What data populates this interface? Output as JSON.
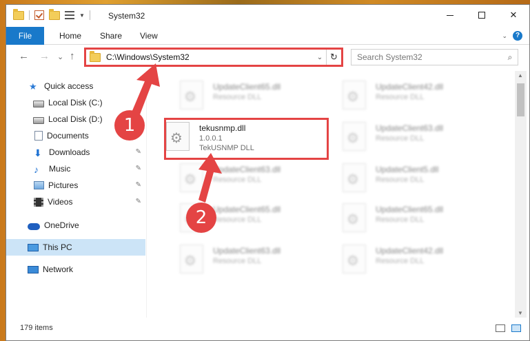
{
  "window": {
    "title": "System32",
    "controls": {
      "minimize": "—",
      "maximize": "□",
      "close": "✕"
    }
  },
  "ribbon": {
    "tabs": [
      "File",
      "Home",
      "Share",
      "View"
    ],
    "help": "?",
    "expand": "⌄"
  },
  "navigation": {
    "back": "←",
    "forward": "→",
    "recent": "⌄",
    "up": "↑",
    "address": "C:\\Windows\\System32",
    "address_dropdown": "⌄",
    "refresh": "↻",
    "search_placeholder": "Search System32",
    "search_icon": "⌕"
  },
  "sidebar": {
    "items": [
      {
        "label": "Quick access",
        "icon": "star-icon"
      },
      {
        "label": "Local Disk (C:)",
        "icon": "local-disk-icon"
      },
      {
        "label": "Local Disk (D:)",
        "icon": "local-disk-icon"
      },
      {
        "label": "Documents",
        "icon": "documents-icon",
        "pinned": true
      },
      {
        "label": "Downloads",
        "icon": "downloads-icon",
        "pinned": true
      },
      {
        "label": "Music",
        "icon": "music-icon",
        "pinned": true
      },
      {
        "label": "Pictures",
        "icon": "pictures-icon",
        "pinned": true
      },
      {
        "label": "Videos",
        "icon": "videos-icon",
        "pinned": true
      },
      {
        "label": "OneDrive",
        "icon": "onedrive-icon"
      },
      {
        "label": "This PC",
        "icon": "this-pc-icon",
        "selected": true
      },
      {
        "label": "Network",
        "icon": "network-icon"
      }
    ],
    "pin_glyph": "📌"
  },
  "files": {
    "highlighted": {
      "name": "tekusnmp.dll",
      "version": "1.0.0.1",
      "description": "TekUSNMP DLL"
    },
    "background": [
      {
        "name": "UpdateClient65.dll",
        "type": "Resource DLL"
      },
      {
        "name": "UpdateClient42.dll",
        "type": "Resource DLL"
      },
      {
        "name": "UpdateClient63.dll",
        "type": "Resource DLL"
      },
      {
        "name": "UpdateClient63.dll",
        "type": "Resource DLL"
      },
      {
        "name": "UpdateClient5.dll",
        "type": "Resource DLL"
      },
      {
        "name": "UpdateClient65.dll",
        "type": "Resource DLL"
      },
      {
        "name": "UpdateClient65.dll",
        "type": "Resource DLL"
      },
      {
        "name": "UpdateClient63.dll",
        "type": "Resource DLL"
      },
      {
        "name": "UpdateClient42.dll",
        "type": "Resource DLL"
      }
    ]
  },
  "status": {
    "item_count": "179 items"
  },
  "annotations": {
    "step1": "1",
    "step2": "2",
    "color": "#e44444"
  }
}
